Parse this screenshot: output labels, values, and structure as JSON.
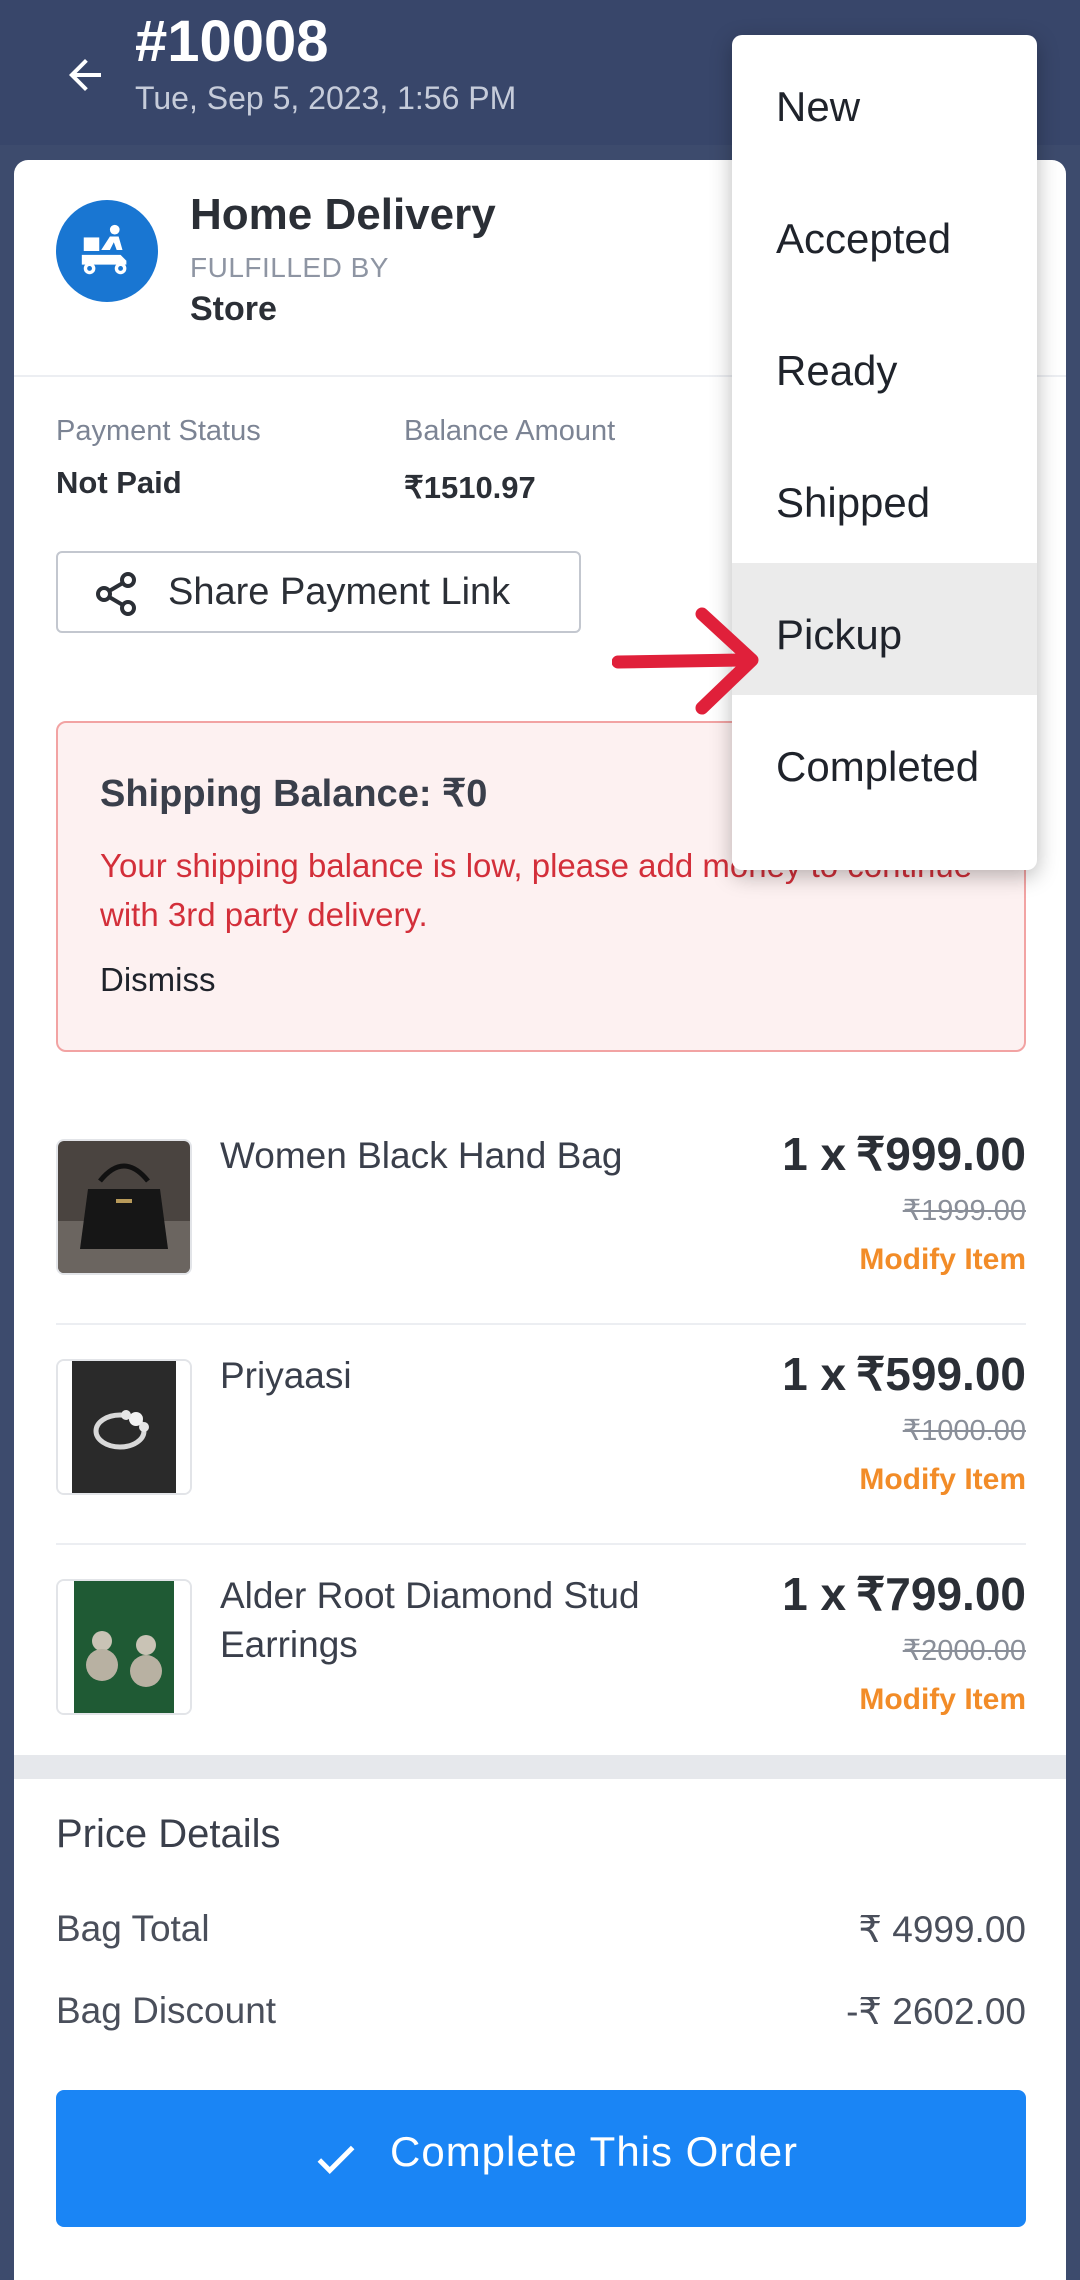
{
  "header": {
    "order_id": "#10008",
    "order_date": "Tue, Sep 5, 2023, 1:56 PM"
  },
  "delivery": {
    "title": "Home Delivery",
    "fulfilled_by_label": "FULFILLED BY",
    "fulfilled_by": "Store"
  },
  "payment": {
    "status_label": "Payment Status",
    "status_value": "Not Paid",
    "balance_label": "Balance Amount",
    "balance_value": "₹1510.97",
    "share_label": "Share Payment Link"
  },
  "alert": {
    "title": "Shipping Balance: ₹0",
    "message": "Your shipping balance is low, please add money to continue with 3rd party delivery.",
    "dismiss": "Dismiss"
  },
  "items": [
    {
      "name": "Women Black Hand Bag",
      "qty": "1 x",
      "price": "₹999.00",
      "mrp": "₹1999.00",
      "modify": "Modify Item"
    },
    {
      "name": "Priyaasi",
      "qty": "1 x",
      "price": "₹599.00",
      "mrp": "₹1000.00",
      "modify": "Modify Item"
    },
    {
      "name": "Alder Root Diamond Stud Earrings",
      "qty": "1 x",
      "price": "₹799.00",
      "mrp": "₹2000.00",
      "modify": "Modify Item"
    }
  ],
  "price_details": {
    "title": "Price Details",
    "rows": [
      {
        "label": "Bag Total",
        "value": "₹ 4999.00"
      },
      {
        "label": "Bag Discount",
        "value": "-₹ 2602.00"
      }
    ]
  },
  "cta": {
    "label": "Complete This Order"
  },
  "status_menu": {
    "items": [
      "New",
      "Accepted",
      "Ready",
      "Shipped",
      "Pickup",
      "Completed"
    ],
    "highlighted": "Pickup"
  },
  "colors": {
    "appbar": "#38466a",
    "primary": "#1a85f5",
    "alert_text": "#d32f3a",
    "modify": "#f28c28",
    "annotation_arrow": "#e0203a"
  }
}
